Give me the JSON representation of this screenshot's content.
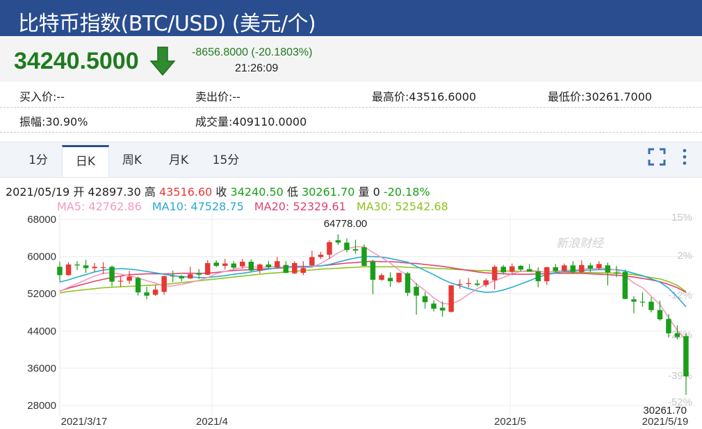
{
  "header": {
    "title": "比特币指数(BTC/USD) (美元/个)"
  },
  "quote": {
    "price": "34240.5000",
    "change": "-8656.8000 (-20.1803%)",
    "time": "21:26:09",
    "direction_icon": "down-arrow-icon",
    "color_down": "#1f7a1f"
  },
  "stats": {
    "bid": "买入价:--",
    "ask": "卖出价:--",
    "high": "最高价:43516.6000",
    "low": "最低价:30261.7000",
    "amplitude": "振幅:30.90%",
    "volume": "成交量:409110.0000"
  },
  "tabs": [
    {
      "label": "1分"
    },
    {
      "label": "日K",
      "active": true
    },
    {
      "label": "周K"
    },
    {
      "label": "月K"
    },
    {
      "label": "15分"
    }
  ],
  "ohlc_line": {
    "date": "2021/05/19",
    "open_label": "开",
    "open": "42897.30",
    "high_label": "高",
    "high": "43516.60",
    "close_label": "收",
    "close": "34240.50",
    "low_label": "低",
    "low": "30261.70",
    "vol_label": "量",
    "vol": "0",
    "pct": "-20.18%"
  },
  "ma_line": {
    "ma5": "MA5: 42762.86",
    "ma10": "MA10: 47528.75",
    "ma20": "MA20: 52329.61",
    "ma30": "MA30: 52542.68"
  },
  "colors": {
    "up": "#e53935",
    "down": "#1a9e1a",
    "ma5": "#f29ac0",
    "ma10": "#29a9d4",
    "ma20": "#e0426f",
    "ma30": "#8cc21e"
  },
  "watermark": "新浪财经",
  "chart_data": {
    "type": "candlestick",
    "y_ticks": [
      "68000",
      "60000",
      "52000",
      "44000",
      "36000",
      "28000"
    ],
    "pct_ticks": [
      "15%",
      "2%",
      "-12%",
      "-26%",
      "-39%",
      "-52%"
    ],
    "x_labels": [
      "2021/3/17",
      "2021/4",
      "2021/5",
      "2021/5/19"
    ],
    "max_label": "64778.00",
    "min_label": "30261.70",
    "ylim": [
      28000,
      68000
    ],
    "candles": [
      [
        57800,
        58900,
        54600,
        56000
      ],
      [
        56000,
        58800,
        55900,
        58300
      ],
      [
        58300,
        59000,
        57100,
        58100
      ],
      [
        58100,
        59300,
        56500,
        57500
      ],
      [
        57500,
        58600,
        56800,
        57800
      ],
      [
        57600,
        58800,
        56200,
        57700
      ],
      [
        57800,
        58100,
        53600,
        54600
      ],
      [
        54600,
        55700,
        53500,
        54800
      ],
      [
        54800,
        56900,
        54100,
        55700
      ],
      [
        55400,
        55700,
        51600,
        52300
      ],
      [
        52300,
        53500,
        50800,
        51600
      ],
      [
        51800,
        53900,
        51500,
        52900
      ],
      [
        52400,
        55900,
        51800,
        55800
      ],
      [
        55900,
        57000,
        54500,
        55800
      ],
      [
        55800,
        56000,
        54700,
        55300
      ],
      [
        55300,
        57800,
        55200,
        56200
      ],
      [
        56400,
        57300,
        55200,
        56100
      ],
      [
        56100,
        59200,
        56000,
        58600
      ],
      [
        58700,
        59200,
        57700,
        58000
      ],
      [
        58000,
        59500,
        57200,
        58500
      ],
      [
        58500,
        59000,
        57300,
        57600
      ],
      [
        57900,
        59500,
        57400,
        58900
      ],
      [
        58900,
        59400,
        56800,
        57000
      ],
      [
        57000,
        58500,
        56400,
        58300
      ],
      [
        58300,
        59100,
        57300,
        57700
      ],
      [
        57700,
        59900,
        57500,
        59000
      ],
      [
        58200,
        59000,
        56400,
        56500
      ],
      [
        56400,
        59000,
        56200,
        58600
      ],
      [
        56500,
        59000,
        56000,
        57500
      ],
      [
        58100,
        61300,
        58000,
        59900
      ],
      [
        59900,
        61000,
        59500,
        60400
      ],
      [
        60400,
        63500,
        59500,
        63100
      ],
      [
        63500,
        64778,
        62500,
        63000
      ],
      [
        63000,
        63900,
        60900,
        61400
      ],
      [
        61600,
        63600,
        60600,
        61300
      ],
      [
        62000,
        62600,
        57900,
        58000
      ],
      [
        58900,
        59300,
        51900,
        55000
      ],
      [
        55000,
        56400,
        54800,
        56000
      ],
      [
        55400,
        56600,
        53500,
        54700
      ],
      [
        54500,
        56500,
        54300,
        56500
      ],
      [
        56400,
        56700,
        51500,
        52200
      ],
      [
        53500,
        54300,
        47500,
        51600
      ],
      [
        51500,
        52400,
        48800,
        50200
      ],
      [
        49900,
        50600,
        48200,
        48800
      ],
      [
        49000,
        50400,
        47100,
        48400
      ],
      [
        48100,
        53900,
        48000,
        53800
      ],
      [
        53900,
        55100,
        53100,
        54100
      ],
      [
        54100,
        55400,
        53300,
        54300
      ],
      [
        54200,
        55000,
        53600,
        53900
      ],
      [
        53900,
        55300,
        53400,
        54900
      ],
      [
        54900,
        58200,
        52900,
        57800
      ],
      [
        57800,
        58200,
        56200,
        56600
      ],
      [
        56700,
        58500,
        56000,
        57900
      ],
      [
        58000,
        58200,
        56800,
        57200
      ],
      [
        57300,
        58400,
        56800,
        56800
      ],
      [
        56800,
        57700,
        53400,
        54700
      ],
      [
        54700,
        57800,
        53900,
        57700
      ],
      [
        57700,
        58400,
        56600,
        56900
      ],
      [
        56900,
        58500,
        56700,
        58100
      ],
      [
        58100,
        59000,
        56300,
        56700
      ],
      [
        56700,
        59200,
        56500,
        58200
      ],
      [
        58100,
        58600,
        56600,
        57400
      ],
      [
        57500,
        59000,
        57100,
        58400
      ],
      [
        58100,
        58700,
        53800,
        56600
      ],
      [
        56600,
        58000,
        55600,
        56500
      ],
      [
        56700,
        57200,
        50800,
        50900
      ],
      [
        50800,
        51500,
        47800,
        50300
      ],
      [
        50300,
        52300,
        49200,
        50200
      ],
      [
        50300,
        51300,
        48000,
        48500
      ],
      [
        48500,
        50500,
        46200,
        46500
      ],
      [
        46600,
        47600,
        42600,
        43500
      ],
      [
        43500,
        45200,
        42200,
        42700
      ],
      [
        42900,
        43516,
        30261,
        34240
      ]
    ],
    "series": [
      {
        "name": "MA5",
        "values": [
          52500,
          53400,
          54200,
          55000,
          55800,
          56400,
          56500,
          56200,
          55900,
          55400,
          54800,
          54300,
          53600,
          53700,
          54000,
          54400,
          54900,
          55500,
          56300,
          56800,
          57300,
          57600,
          57800,
          57700,
          57800,
          57900,
          57600,
          57700,
          57600,
          57700,
          58500,
          59600,
          60800,
          61700,
          62100,
          62100,
          60900,
          59800,
          58600,
          57100,
          55900,
          54100,
          52700,
          51100,
          49900,
          49800,
          50600,
          51900,
          53100,
          54000,
          54800,
          55500,
          56300,
          56800,
          57000,
          56900,
          56600,
          56900,
          57100,
          57100,
          57300,
          57400,
          57500,
          57400,
          57100,
          55800,
          54300,
          53300,
          51500,
          49700,
          46900,
          44100,
          42100
        ]
      },
      {
        "name": "MA10",
        "values": [
          54500,
          55000,
          55600,
          56100,
          56700,
          57100,
          57300,
          57400,
          57300,
          57100,
          56800,
          56500,
          56200,
          55900,
          55700,
          55600,
          55500,
          55500,
          55700,
          55900,
          56200,
          56400,
          56700,
          57000,
          57300,
          57600,
          57800,
          57900,
          57900,
          57900,
          58000,
          58300,
          58800,
          59300,
          59700,
          60000,
          60000,
          59900,
          59600,
          59200,
          58800,
          57900,
          57000,
          56100,
          55100,
          54300,
          53700,
          53100,
          52600,
          52300,
          52400,
          52800,
          53400,
          54100,
          54800,
          55600,
          56100,
          56500,
          56800,
          56900,
          57000,
          57100,
          57200,
          57200,
          57200,
          56900,
          56400,
          55900,
          55200,
          54500,
          53200,
          51300,
          49200
        ]
      },
      {
        "name": "MA20",
        "values": [
          52600,
          53200,
          53700,
          54200,
          54700,
          55100,
          55500,
          55800,
          56100,
          56200,
          56300,
          56300,
          56300,
          56300,
          56400,
          56400,
          56400,
          56400,
          56600,
          56800,
          57000,
          57100,
          57200,
          57300,
          57400,
          57500,
          57600,
          57700,
          57800,
          57900,
          58000,
          58200,
          58400,
          58600,
          58700,
          58900,
          59000,
          58900,
          58900,
          58800,
          58600,
          58500,
          58300,
          58100,
          57900,
          57600,
          57300,
          57000,
          56700,
          56500,
          56400,
          56300,
          56200,
          56200,
          56200,
          56300,
          56300,
          56400,
          56400,
          56400,
          56400,
          56300,
          56200,
          56100,
          56000,
          55800,
          55600,
          55300,
          55000,
          54600,
          54000,
          53300,
          52300
        ]
      },
      {
        "name": "MA30",
        "values": [
          52200,
          52500,
          52700,
          52900,
          53100,
          53300,
          53400,
          53500,
          53600,
          53700,
          53800,
          53900,
          54000,
          54200,
          54400,
          54600,
          54800,
          55000,
          55200,
          55400,
          55600,
          55800,
          56000,
          56200,
          56400,
          56500,
          56700,
          56800,
          57000,
          57100,
          57300,
          57400,
          57500,
          57600,
          57700,
          57800,
          57800,
          57800,
          57800,
          57800,
          57700,
          57600,
          57600,
          57500,
          57400,
          57300,
          57200,
          57100,
          57000,
          57000,
          56900,
          56900,
          56900,
          56800,
          56800,
          56800,
          56700,
          56700,
          56700,
          56600,
          56600,
          56600,
          56500,
          56500,
          56400,
          56300,
          56100,
          55800,
          55500,
          55200,
          54600,
          53800,
          52500
        ]
      }
    ]
  }
}
